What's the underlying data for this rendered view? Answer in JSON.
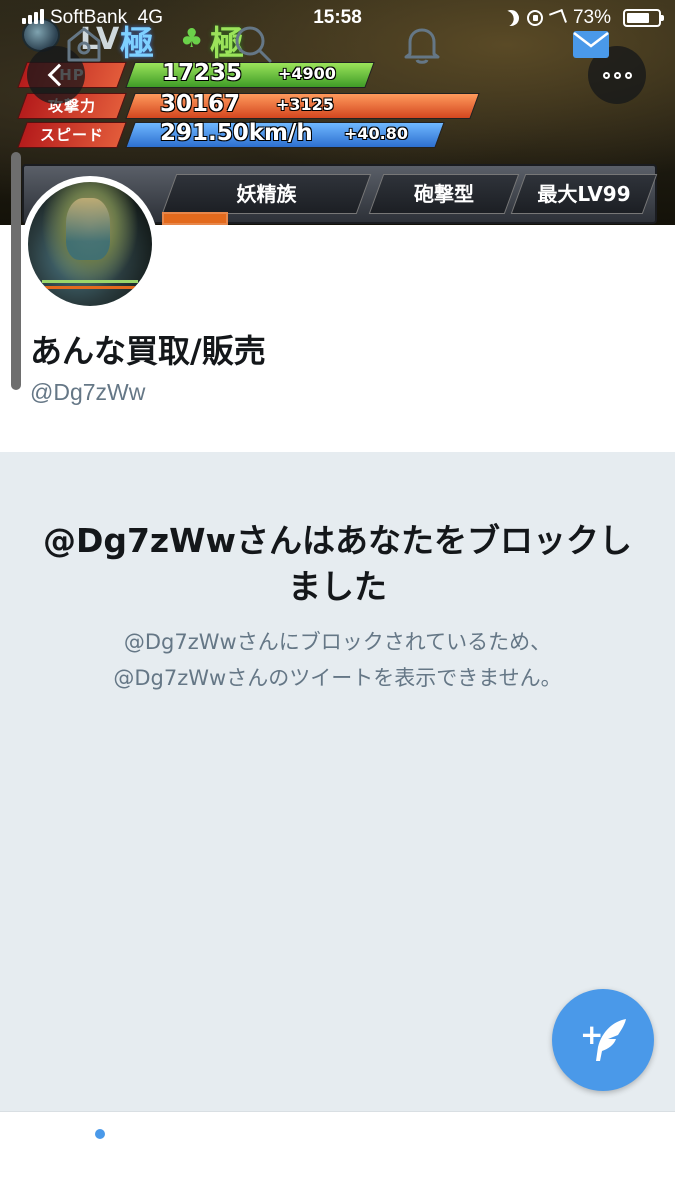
{
  "status_bar": {
    "carrier": "SoftBank",
    "network": "4G",
    "time": "15:58",
    "battery_percent": "73%",
    "battery_level": 0.73
  },
  "banner": {
    "lv_text": "LV",
    "kiwame_1": "極",
    "kiwame_2": "極",
    "stats": {
      "hp_label": "HP",
      "hp_value": "17235",
      "hp_plus": "+4900",
      "atk_label": "攻撃力",
      "atk_value": "30167",
      "atk_plus": "+3125",
      "spd_label": "スピード",
      "spd_value": "291.50km/h",
      "spd_plus": "+40.80"
    },
    "classes": [
      "妖精族",
      "砲撃型",
      "最大LV99"
    ]
  },
  "profile": {
    "display_name": "あんな買取/販売",
    "handle": "@Dg7zWw"
  },
  "blocked": {
    "title": "@Dg7zWwさんはあなたをブロックしました",
    "description_line1": "@Dg7zWwさんにブロックされているため、",
    "description_line2": "@Dg7zWwさんのツイートを表示できません。"
  },
  "compose": {
    "plus": "+"
  },
  "tabs": [
    {
      "icon": "home-icon",
      "has_badge": true
    },
    {
      "icon": "search-icon"
    },
    {
      "icon": "bell-icon"
    },
    {
      "icon": "mail-icon",
      "active": true
    }
  ],
  "colors": {
    "accent": "#4a99e9",
    "panel_bg": "#e6ecf0",
    "secondary_text": "#657786",
    "primary_text": "#14171a"
  }
}
